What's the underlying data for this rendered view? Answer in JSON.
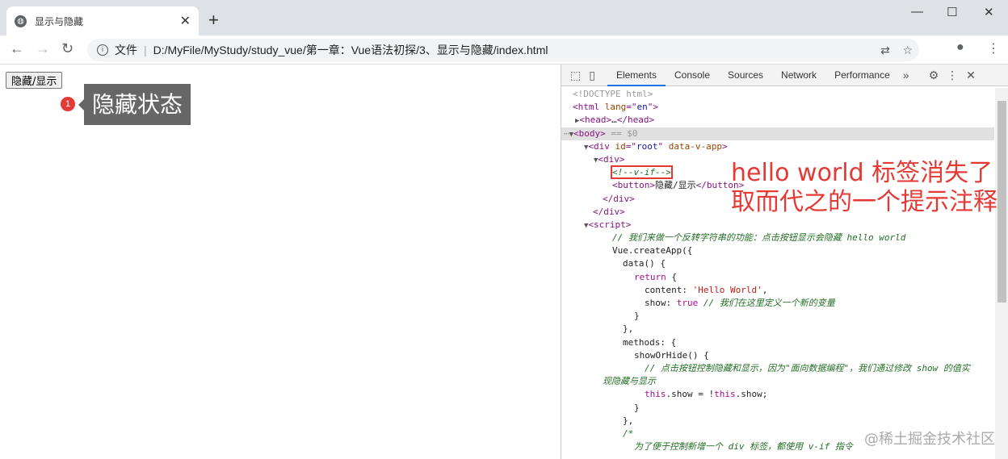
{
  "browser": {
    "tab_title": "显示与隐藏",
    "address_label": "文件",
    "url": "D:/MyFile/MyStudy/study_vue/第一章：Vue语法初探/3、显示与隐藏/index.html"
  },
  "page": {
    "button_label": "隐藏/显示",
    "badge": "1",
    "tooltip": "隐藏状态"
  },
  "devtools": {
    "tabs": [
      "Elements",
      "Console",
      "Sources",
      "Network",
      "Performance"
    ],
    "lines": [
      {
        "i": 708,
        "s": [
          [
            "g",
            "<!DOCTYPE html>"
          ]
        ]
      },
      {
        "i": 708,
        "s": [
          [
            "t",
            "<html "
          ],
          [
            "a",
            "lang"
          ],
          [
            "t",
            "=\""
          ],
          [
            "v",
            "en"
          ],
          [
            "t",
            "\">"
          ]
        ]
      },
      {
        "i": 711,
        "s": [
          [
            "tri",
            "▶"
          ],
          [
            "t",
            "<head>"
          ],
          [
            "p",
            "…"
          ],
          [
            "t",
            "</head>"
          ]
        ]
      },
      {
        "i": 697,
        "sel": true,
        "s": [
          [
            "g",
            "⋯"
          ],
          [
            "tri",
            "▼"
          ],
          [
            "t",
            "<body>"
          ],
          [
            "g",
            " == "
          ],
          [
            "g",
            "$0"
          ]
        ]
      },
      {
        "i": 722,
        "s": [
          [
            "tri",
            "▼"
          ],
          [
            "t",
            "<div "
          ],
          [
            "a",
            "id"
          ],
          [
            "t",
            "=\""
          ],
          [
            "v",
            "root"
          ],
          [
            "t",
            "\" "
          ],
          [
            "a",
            "data-v-app"
          ],
          [
            "t",
            ">"
          ]
        ]
      },
      {
        "i": 734,
        "s": [
          [
            "tri",
            "▼"
          ],
          [
            "t",
            "<div>"
          ]
        ]
      },
      {
        "i": 757,
        "box": true,
        "s": [
          [
            "c",
            "<!--v-if-->"
          ]
        ]
      },
      {
        "i": 757,
        "s": [
          [
            "t",
            "<button>"
          ],
          [
            "p",
            "隐藏/显示"
          ],
          [
            "t",
            "</button>"
          ]
        ]
      },
      {
        "i": 745,
        "s": [
          [
            "t",
            "</div>"
          ]
        ]
      },
      {
        "i": 733,
        "s": [
          [
            "t",
            "</div>"
          ]
        ]
      },
      {
        "i": 722,
        "s": [
          [
            "tri",
            "▼"
          ],
          [
            "t",
            "<script>"
          ]
        ]
      },
      {
        "i": 757,
        "s": [
          [
            "c",
            "// 我们来做一个反转字符串的功能：点击按钮显示会隐藏 hello world"
          ]
        ]
      },
      {
        "i": 757,
        "s": [
          [
            "p",
            "Vue.createApp({"
          ]
        ]
      },
      {
        "i": 770,
        "s": [
          [
            "p",
            "data() {"
          ]
        ]
      },
      {
        "i": 784,
        "s": [
          [
            "k",
            "return"
          ],
          [
            "p",
            " {"
          ]
        ]
      },
      {
        "i": 797,
        "s": [
          [
            "p",
            "content: "
          ],
          [
            "s",
            "'Hello World'"
          ],
          [
            "p",
            ","
          ]
        ]
      },
      {
        "i": 797,
        "s": [
          [
            "p",
            "show: "
          ],
          [
            "k",
            "true"
          ],
          [
            "c",
            " // 我们在这里定义一个新的变量"
          ]
        ]
      },
      {
        "i": 784,
        "s": [
          [
            "p",
            "}"
          ]
        ]
      },
      {
        "i": 770,
        "s": [
          [
            "p",
            "},"
          ]
        ]
      },
      {
        "i": 770,
        "s": [
          [
            "p",
            "methods: {"
          ]
        ]
      },
      {
        "i": 784,
        "s": [
          [
            "p",
            "showOrHide() {"
          ]
        ]
      },
      {
        "i": 797,
        "s": [
          [
            "c",
            "// 点击按钮控制隐藏和显示，因为\"面向数据编程\"，我们通过修改 show 的值实"
          ]
        ]
      },
      {
        "i": 745,
        "s": [
          [
            "c",
            "现隐藏与显示"
          ]
        ]
      },
      {
        "i": 797,
        "s": [
          [
            "k",
            "this"
          ],
          [
            "p",
            ".show = !"
          ],
          [
            "k",
            "this"
          ],
          [
            "p",
            ".show;"
          ]
        ]
      },
      {
        "i": 784,
        "s": [
          [
            "p",
            "}"
          ]
        ]
      },
      {
        "i": 770,
        "s": [
          [
            "p",
            "},"
          ]
        ]
      },
      {
        "i": 770,
        "s": [
          [
            "c",
            "/*"
          ]
        ]
      },
      {
        "i": 784,
        "s": [
          [
            "c",
            "为了便于控制新增一个 div 标签，都使用 v-if 指令"
          ]
        ]
      }
    ]
  },
  "annotation": {
    "line1": "hello world 标签消失了",
    "line2": "取而代之的一个提示注释"
  },
  "watermark": "@稀土掘金技术社区"
}
